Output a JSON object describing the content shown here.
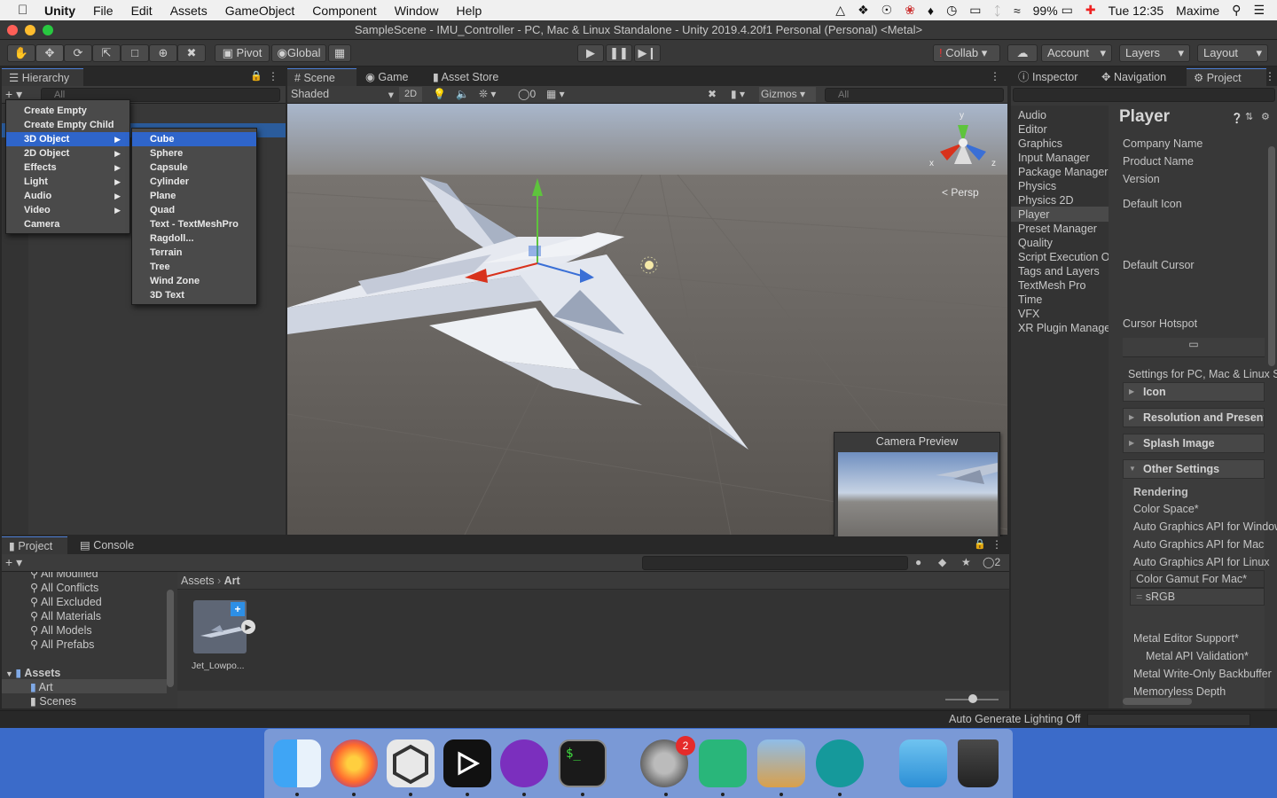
{
  "menubar": {
    "apple": "",
    "app": "Unity",
    "items": [
      "File",
      "Edit",
      "Assets",
      "GameObject",
      "Component",
      "Window",
      "Help"
    ],
    "battery": "99%",
    "clock": "Tue 12:35",
    "user": "Maxime"
  },
  "window": {
    "title": "SampleScene - IMU_Controller - PC, Mac & Linux Standalone - Unity 2019.4.20f1 Personal (Personal) <Metal>"
  },
  "toolbar": {
    "pivot": "Pivot",
    "global": "Global",
    "collab": "Collab",
    "account": "Account",
    "layers": "Layers",
    "layout": "Layout"
  },
  "hierarchy": {
    "tab": "Hierarchy",
    "search": "All"
  },
  "create_menu": {
    "items": [
      "Create Empty",
      "Create Empty Child",
      "3D Object",
      "2D Object",
      "Effects",
      "Light",
      "Audio",
      "Video",
      "Camera"
    ],
    "highlighted": "3D Object"
  },
  "sub_menu": {
    "items": [
      "Cube",
      "Sphere",
      "Capsule",
      "Cylinder",
      "Plane",
      "Quad",
      "Text - TextMeshPro",
      "Ragdoll...",
      "Terrain",
      "Tree",
      "Wind Zone",
      "3D Text"
    ],
    "highlighted": "Cube"
  },
  "scene": {
    "tabs": [
      "Scene",
      "Game",
      "Asset Store"
    ],
    "shading": "Shaded",
    "mode2d": "2D",
    "hidden_count": "0",
    "gizmos": "Gizmos",
    "search": "All",
    "persp": "Persp",
    "axis_x": "x",
    "axis_z": "z",
    "axis_y": "y",
    "camera_preview": "Camera Preview"
  },
  "inspector": {
    "tabs": [
      "Inspector",
      "Navigation",
      "Project"
    ]
  },
  "project_settings": {
    "categories": [
      "Audio",
      "Editor",
      "Graphics",
      "Input Manager",
      "Package Manager",
      "Physics",
      "Physics 2D",
      "Player",
      "Preset Manager",
      "Quality",
      "Script Execution Order",
      "Tags and Layers",
      "TextMesh Pro",
      "Time",
      "VFX",
      "XR Plugin Management"
    ],
    "selected": "Player"
  },
  "player": {
    "title": "Player",
    "company_name": "Company Name",
    "product_name": "Product Name",
    "version": "Version",
    "default_icon": "Default Icon",
    "default_cursor": "Default Cursor",
    "cursor_hotspot": "Cursor Hotspot",
    "settings_for": "Settings for PC, Mac & Linux Standalone",
    "icon": "Icon",
    "resolution": "Resolution and Presentation",
    "splash": "Splash Image",
    "other": "Other Settings",
    "rendering": "Rendering",
    "color_space": "Color Space*",
    "agfw": "Auto Graphics API  for Windows",
    "agfm": "Auto Graphics API  for Mac",
    "agfl": "Auto Graphics API  for Linux",
    "gamut": "Color Gamut For Mac*",
    "srgb": "sRGB",
    "metal_editor": "Metal Editor Support*",
    "metal_validation": "Metal API Validation*",
    "metal_write": "Metal Write-Only Backbuffer",
    "memoryless": "Memoryless Depth"
  },
  "project": {
    "tabs": [
      "Project",
      "Console"
    ],
    "favorites": [
      "All Modified",
      "All Conflicts",
      "All Excluded",
      "All Materials",
      "All Models",
      "All Prefabs"
    ],
    "assets_root": "Assets",
    "folders": [
      "Art",
      "Scenes"
    ],
    "breadcrumb": [
      "Assets",
      "Art"
    ],
    "asset": "Jet_Lowpo...",
    "hidden_count": "2"
  },
  "status": {
    "lighting": "Auto Generate Lighting Off"
  },
  "dock": {
    "badge": "2"
  }
}
